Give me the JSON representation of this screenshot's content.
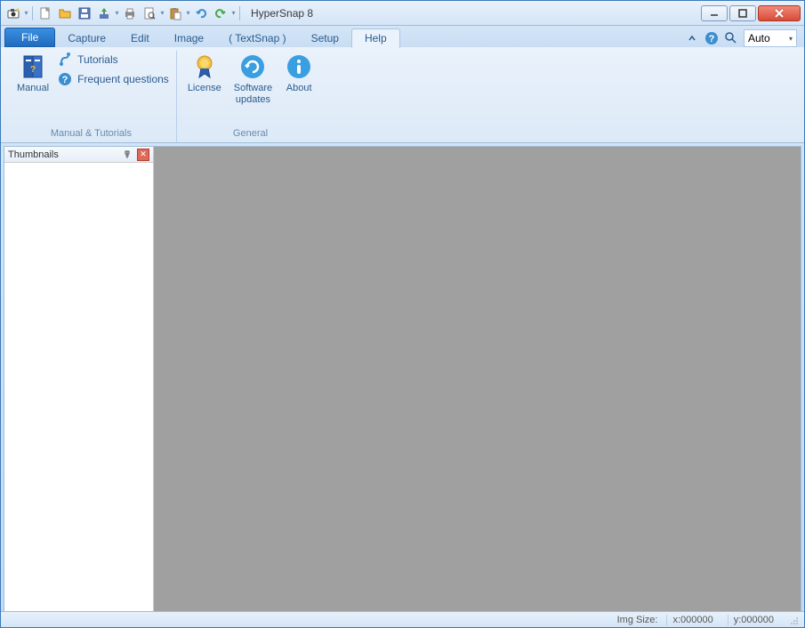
{
  "titlebar": {
    "title": "HyperSnap 8"
  },
  "tabs": {
    "file": "File",
    "items": [
      "Capture",
      "Edit",
      "Image",
      "( TextSnap )",
      "Setup",
      "Help"
    ],
    "active": "Help"
  },
  "search": {
    "value": "Auto"
  },
  "ribbon": {
    "groups": [
      {
        "label": "Manual & Tutorials",
        "manual": "Manual",
        "links": [
          {
            "icon": "tutorials-icon",
            "label": "Tutorials"
          },
          {
            "icon": "faq-icon",
            "label": "Frequent questions"
          }
        ]
      },
      {
        "label": "General",
        "buttons": [
          {
            "icon": "license-icon",
            "label": "License"
          },
          {
            "icon": "updates-icon",
            "label": "Software\nupdates"
          },
          {
            "icon": "about-icon",
            "label": "About"
          }
        ]
      }
    ]
  },
  "thumbnails": {
    "title": "Thumbnails"
  },
  "statusbar": {
    "imgsize_label": "Img Size:",
    "x": "x:000000",
    "y": "y:000000"
  }
}
